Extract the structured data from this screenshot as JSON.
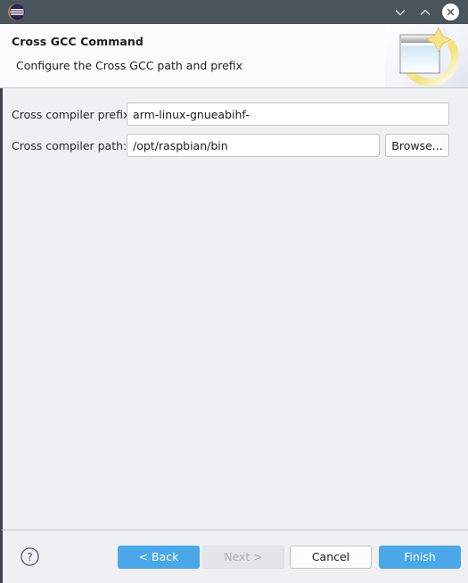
{
  "titlebar": {
    "logo_icon": "eclipse-logo-icon",
    "minimize_icon": "chevron-down-icon",
    "maximize_icon": "chevron-up-icon",
    "close_icon": "close-icon",
    "background_color": "#4a545d"
  },
  "header": {
    "title": "Cross GCC Command",
    "subtitle": "Configure the Cross GCC path and prefix",
    "banner_icon": "wizard-window-sparkle-icon",
    "background_color": "#fcfcfc"
  },
  "form": {
    "fields": [
      {
        "label": "Cross compiler prefix:",
        "value": "arm-linux-gnueabihf-",
        "placeholder": ""
      },
      {
        "label": "Cross compiler path:",
        "value": "/opt/raspbian/bin",
        "placeholder": ""
      }
    ],
    "browse_label": "Browse..."
  },
  "footer": {
    "help_icon": "help-question-icon",
    "buttons": {
      "back": "< Back",
      "next": "Next >",
      "cancel": "Cancel",
      "finish": "Finish"
    },
    "accent_color": "#4aa8e8",
    "disabled_color": "#e3e5e6"
  }
}
